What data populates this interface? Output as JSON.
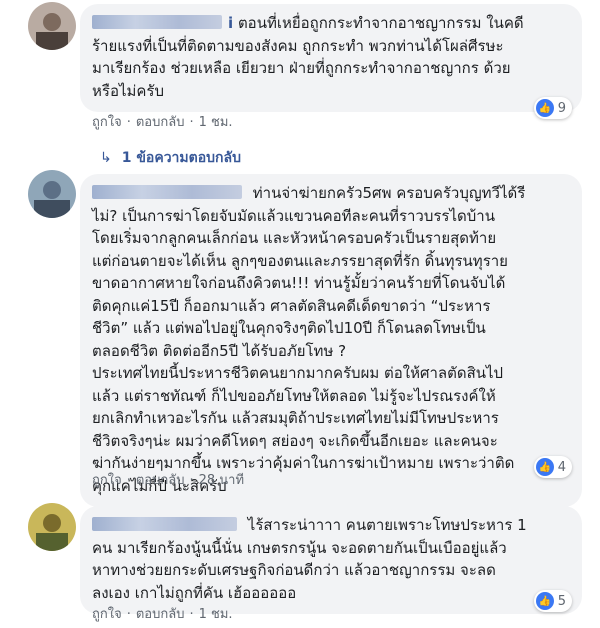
{
  "comments": [
    {
      "name_tail": "i",
      "lines": [
        "ตอนที่เหยื่อถูกกระทำจากอาชญากรรม ในคดี",
        "ร้ายแรงที่เป็นที่ติดตามของสังคม ถูกกระทำ พวกท่านได้โผล่ศีรษะ",
        "มาเรียกร้อง ช่วยเหลือ เยียวยา ฝ่ายที่ถูกกระทำจากอาชญากร ด้วย",
        "หรือไม่ครับ"
      ],
      "like": "ถูกใจ",
      "reply": "ตอบกลับ",
      "time": "1 ชม.",
      "reactions": "9",
      "replies_label": "1 ข้อความตอบกลับ"
    },
    {
      "name_tail": "",
      "lines": [
        "ท่านจ่าฆ่ายกครัว5ศพ ครอบครัวบุญทวีได้รี",
        "ไม่? เป็นการฆ่าโดยจับมัดแล้วแขวนคอทีละคนที่ราวบรรไดบ้าน",
        "โดยเริ่มจากลูกคนเล็กก่อน และหัวหน้าครอบครัวเป็นรายสุดท้าย",
        "แต่ก่อนตายจะได้เห็น ลูกๆของตนและภรรยาสุดที่รัก ดิ้นทุรนทุราย",
        "ขาดอากาศหายใจก่อนถึงคิวตน!!! ท่านรู้มั้ยว่าคนร้ายที่โดนจับได้",
        "ติดคุกแค่15ปี ก็ออกมาแล้ว ศาลตัดสินคดีเด็ดขาดว่า “ประหาร",
        "ชีวิต” แล้ว แต่พอไปอยู่ในคุกจริงๆติดไป10ปี ก็โดนลดโทษเป็น",
        "ตลอดชีวิต ติดต่ออีก5ปี ได้รับอภัยโทษ ?",
        "ประเทศไทยนี้ประหารชีวิตคนยากมากครับผม ต่อให้ศาลตัดสินไป",
        "แล้ว แต่ราชทัณฑ์ ก็ไปขออภัยโทษให้ตลอด ไม่รู้จะไปรณรงค์ให้",
        "ยกเลิกทำเหวอะไรกัน แล้วสมมุติถ้าประเทศไทยไม่มีโทษประหาร",
        "ชีวิตจริงๆน่ะ ผมว่าคดีโหดๆ สย่องๆ จะเกิดขึ้นอีกเยอะ และคนจะ",
        "ฆ่ากันง่ายๆมากขึ้น เพราะว่าคุ้มค่าในการฆ่าเป้าหมาย เพราะว่าติด",
        "คุกแค่ไม่กี่ปี น่ะสิครับ"
      ],
      "like": "ถูกใจ",
      "reply": "ตอบกลับ",
      "time": "28 นาที",
      "reactions": "4"
    },
    {
      "name_tail": "",
      "lines": [
        "ไร้สาระน่าาาา คนตายเพราะโทษประหาร 1",
        "คน มาเรียกร้องนู้นนี้นั่น เกษตรกรนู้น จะอดตายกันเป็นเบืออยู่แล้ว",
        "หาทางช่วยยกระดับเศรษฐกิจก่อนดีกว่า แล้วอาชญากรรม จะลด",
        "ลงเอง เกาไม่ถูกที่คัน เฮ้ออออออ"
      ],
      "like": "ถูกใจ",
      "reply": "ตอบกลับ",
      "time": "1 ชม.",
      "reactions": "5"
    }
  ],
  "colors": {
    "link": "#385898",
    "bubble": "#f2f3f5",
    "like": "#3b78f4"
  },
  "icons": {
    "like": "thumbs-up-icon",
    "reply_arrow": "reply-arrow-icon"
  }
}
